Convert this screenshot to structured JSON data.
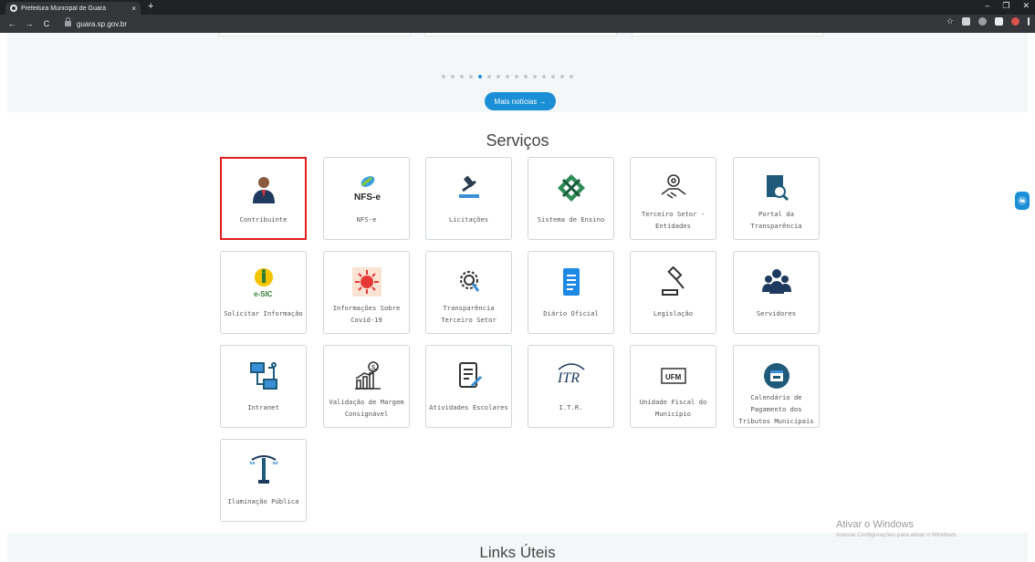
{
  "browser": {
    "tab_title": "Prefeitura Municipal de Guará",
    "tab_close": "×",
    "new_tab": "+",
    "window_controls": [
      "–",
      "❐",
      "✕"
    ],
    "url": "guara.sp.gov.br",
    "nav": {
      "back": "←",
      "forward": "→",
      "reload": "C"
    }
  },
  "news": {
    "pager_total": 15,
    "pager_active": 5,
    "more_label": "Mais notícias →"
  },
  "services": {
    "title": "Serviços",
    "items": [
      {
        "label": "Contribuinte",
        "icon": "person-icon"
      },
      {
        "label": "NFS-e",
        "icon": "nfse-icon"
      },
      {
        "label": "Licitações",
        "icon": "gavel-icon"
      },
      {
        "label": "Sistema de Ensino",
        "icon": "education-icon"
      },
      {
        "label": "Terceiro Setor - Entidades",
        "icon": "handshake-icon"
      },
      {
        "label": "Portal da Transparência",
        "icon": "document-search-icon"
      },
      {
        "label": "Solicitar Informação",
        "icon": "esic-icon"
      },
      {
        "label": "Informações Sobre Covid-19",
        "icon": "virus-icon"
      },
      {
        "label": "Transparência Terceiro Setor",
        "icon": "gear-search-icon"
      },
      {
        "label": "Diário Oficial",
        "icon": "newspaper-icon"
      },
      {
        "label": "Legislação",
        "icon": "law-gavel-icon"
      },
      {
        "label": "Servidores",
        "icon": "people-icon"
      },
      {
        "label": "Intranet",
        "icon": "network-icon"
      },
      {
        "label": "Validação de Margem Consignável",
        "icon": "chart-money-icon"
      },
      {
        "label": "Atividades Escolares",
        "icon": "notepad-icon"
      },
      {
        "label": "I.T.R.",
        "icon": "itr-icon"
      },
      {
        "label": "Unidade Fiscal do Município",
        "icon": "ufm-icon"
      },
      {
        "label": "Calendário de Pagamento dos Tributos Municipais",
        "icon": "calendar-icon"
      },
      {
        "label": "Iluminação Pública",
        "icon": "streetlight-icon"
      }
    ]
  },
  "links": {
    "title": "Links Úteis"
  },
  "windows_activation": {
    "line1": "Ativar o Windows",
    "line2": "Acesse Configurações para ativar o Windows."
  },
  "colors": {
    "accent": "#1a8fd6",
    "selection": "#e01e1e"
  }
}
